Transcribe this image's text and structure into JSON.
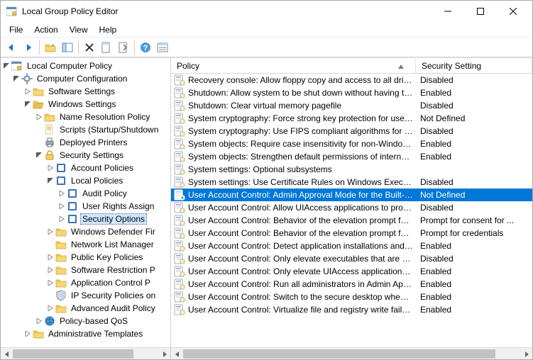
{
  "window": {
    "title": "Local Group Policy Editor"
  },
  "menubar": [
    "File",
    "Action",
    "View",
    "Help"
  ],
  "columns": {
    "policy": "Policy",
    "setting": "Security Setting"
  },
  "tree": {
    "root": "Local Computer Policy",
    "compCfg": "Computer Configuration",
    "softSet": "Software Settings",
    "winSet": "Windows Settings",
    "nameRes": "Name Resolution Policy",
    "scripts": "Scripts (Startup/Shutdown",
    "depPrint": "Deployed Printers",
    "secSet": "Security Settings",
    "acctPol": "Account Policies",
    "locPol": "Local Policies",
    "auditPol": "Audit Policy",
    "userRights": "User Rights Assign",
    "secOpt": "Security Options",
    "winDef": "Windows Defender Fir",
    "netList": "Network List Manager",
    "pubKey": "Public Key Policies",
    "softRes": "Software Restriction P",
    "appCtl": "Application Control P",
    "ipSec": "IP Security Policies on",
    "advAudit": "Advanced Audit Policy",
    "qos": "Policy-based QoS",
    "adminTmpl": "Administrative Templates"
  },
  "policies": [
    {
      "name": "Recovery console: Allow floppy copy and access to all drives...",
      "setting": "Disabled",
      "sel": false
    },
    {
      "name": "Shutdown: Allow system to be shut down without having to...",
      "setting": "Enabled",
      "sel": false
    },
    {
      "name": "Shutdown: Clear virtual memory pagefile",
      "setting": "Disabled",
      "sel": false
    },
    {
      "name": "System cryptography: Force strong key protection for user k...",
      "setting": "Not Defined",
      "sel": false
    },
    {
      "name": "System cryptography: Use FIPS compliant algorithms for en...",
      "setting": "Disabled",
      "sel": false
    },
    {
      "name": "System objects: Require case insensitivity for non-Windows ...",
      "setting": "Enabled",
      "sel": false
    },
    {
      "name": "System objects: Strengthen default permissions of internal s...",
      "setting": "Enabled",
      "sel": false
    },
    {
      "name": "System settings: Optional subsystems",
      "setting": "",
      "sel": false
    },
    {
      "name": "System settings: Use Certificate Rules on Windows Executab...",
      "setting": "Disabled",
      "sel": false
    },
    {
      "name": "User Account Control: Admin Approval Mode for the Built-i...",
      "setting": "Not Defined",
      "sel": true
    },
    {
      "name": "User Account Control: Allow UIAccess applications to prom...",
      "setting": "Disabled",
      "sel": false
    },
    {
      "name": "User Account Control: Behavior of the elevation prompt for ...",
      "setting": "Prompt for consent for ...",
      "sel": false
    },
    {
      "name": "User Account Control: Behavior of the elevation prompt for ...",
      "setting": "Prompt for credentials",
      "sel": false
    },
    {
      "name": "User Account Control: Detect application installations and p...",
      "setting": "Enabled",
      "sel": false
    },
    {
      "name": "User Account Control: Only elevate executables that are sig...",
      "setting": "Disabled",
      "sel": false
    },
    {
      "name": "User Account Control: Only elevate UIAccess applications th...",
      "setting": "Enabled",
      "sel": false
    },
    {
      "name": "User Account Control: Run all administrators in Admin Appr...",
      "setting": "Enabled",
      "sel": false
    },
    {
      "name": "User Account Control: Switch to the secure desktop when pr...",
      "setting": "Enabled",
      "sel": false
    },
    {
      "name": "User Account Control: Virtualize file and registry write failure...",
      "setting": "Enabled",
      "sel": false
    }
  ]
}
